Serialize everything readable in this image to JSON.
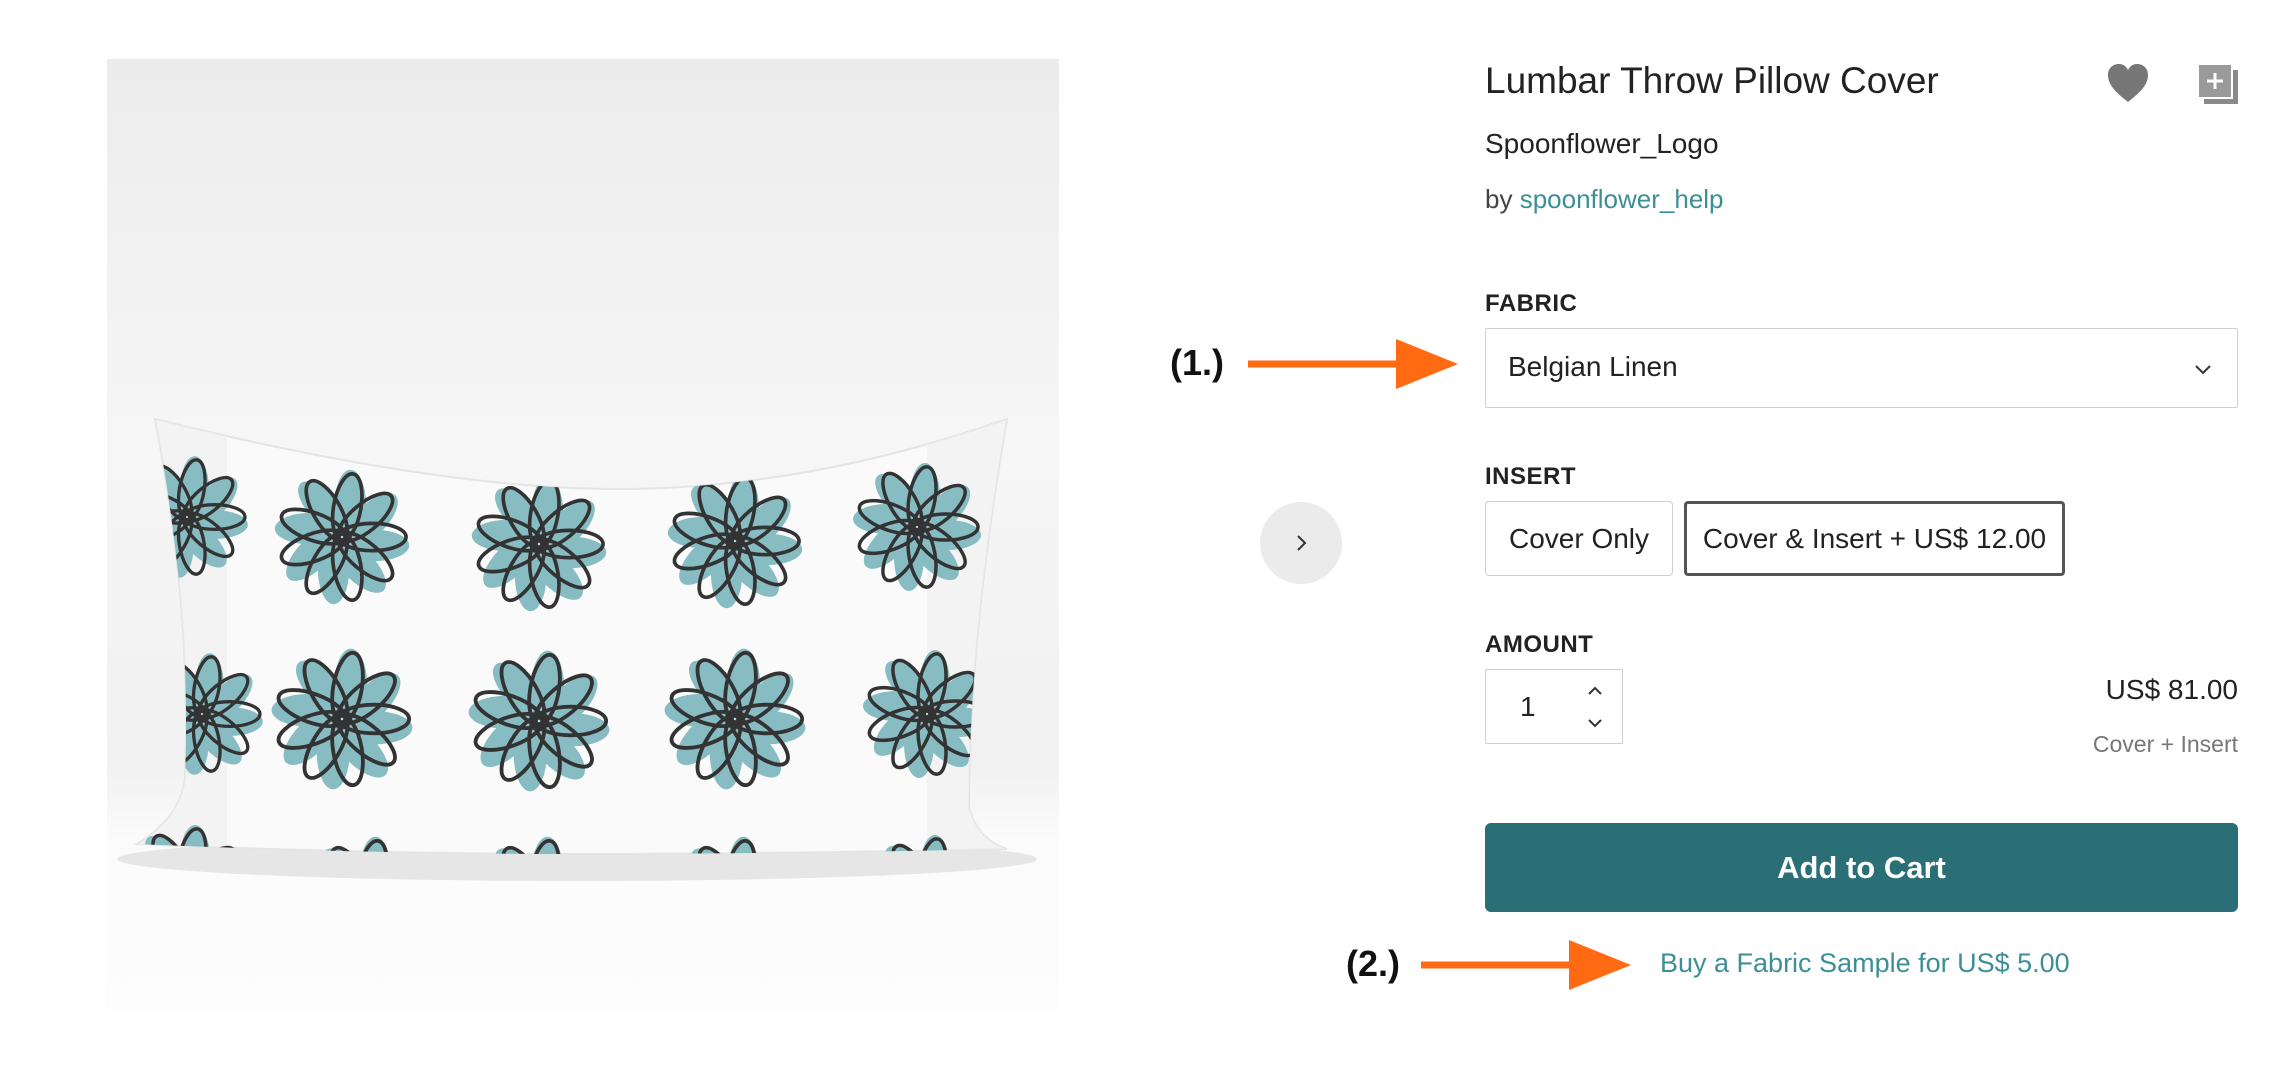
{
  "product": {
    "title": "Lumbar Throw Pillow Cover",
    "design_name": "Spoonflower_Logo",
    "by_prefix": "by",
    "designer": "spoonflower_help"
  },
  "icons": {
    "favorite": "heart-icon",
    "add_to_collection": "add-to-collection-icon",
    "next": "chevron-right-icon",
    "dropdown": "chevron-down-icon",
    "stepper_up": "chevron-up-icon",
    "stepper_down": "chevron-down-icon"
  },
  "fabric": {
    "label": "FABRIC",
    "selected": "Belgian Linen"
  },
  "insert": {
    "label": "INSERT",
    "options": [
      {
        "label": "Cover Only",
        "selected": false
      },
      {
        "label": "Cover & Insert + US$ 12.00",
        "selected": true
      }
    ]
  },
  "amount": {
    "label": "AMOUNT",
    "quantity": "1"
  },
  "price": {
    "value": "US$ 81.00",
    "note": "Cover + Insert"
  },
  "cart": {
    "button_label": "Add to Cart"
  },
  "sample": {
    "link_text": "Buy a Fabric Sample for US$ 5.00"
  },
  "annotations": {
    "first": "(1.)",
    "second": "(2.)",
    "arrow_color": "#ff6a13"
  },
  "colors": {
    "accent": "#2a6f76",
    "link": "#3c8f96",
    "flower_fill": "#86bcc2",
    "flower_stroke": "#333333"
  }
}
